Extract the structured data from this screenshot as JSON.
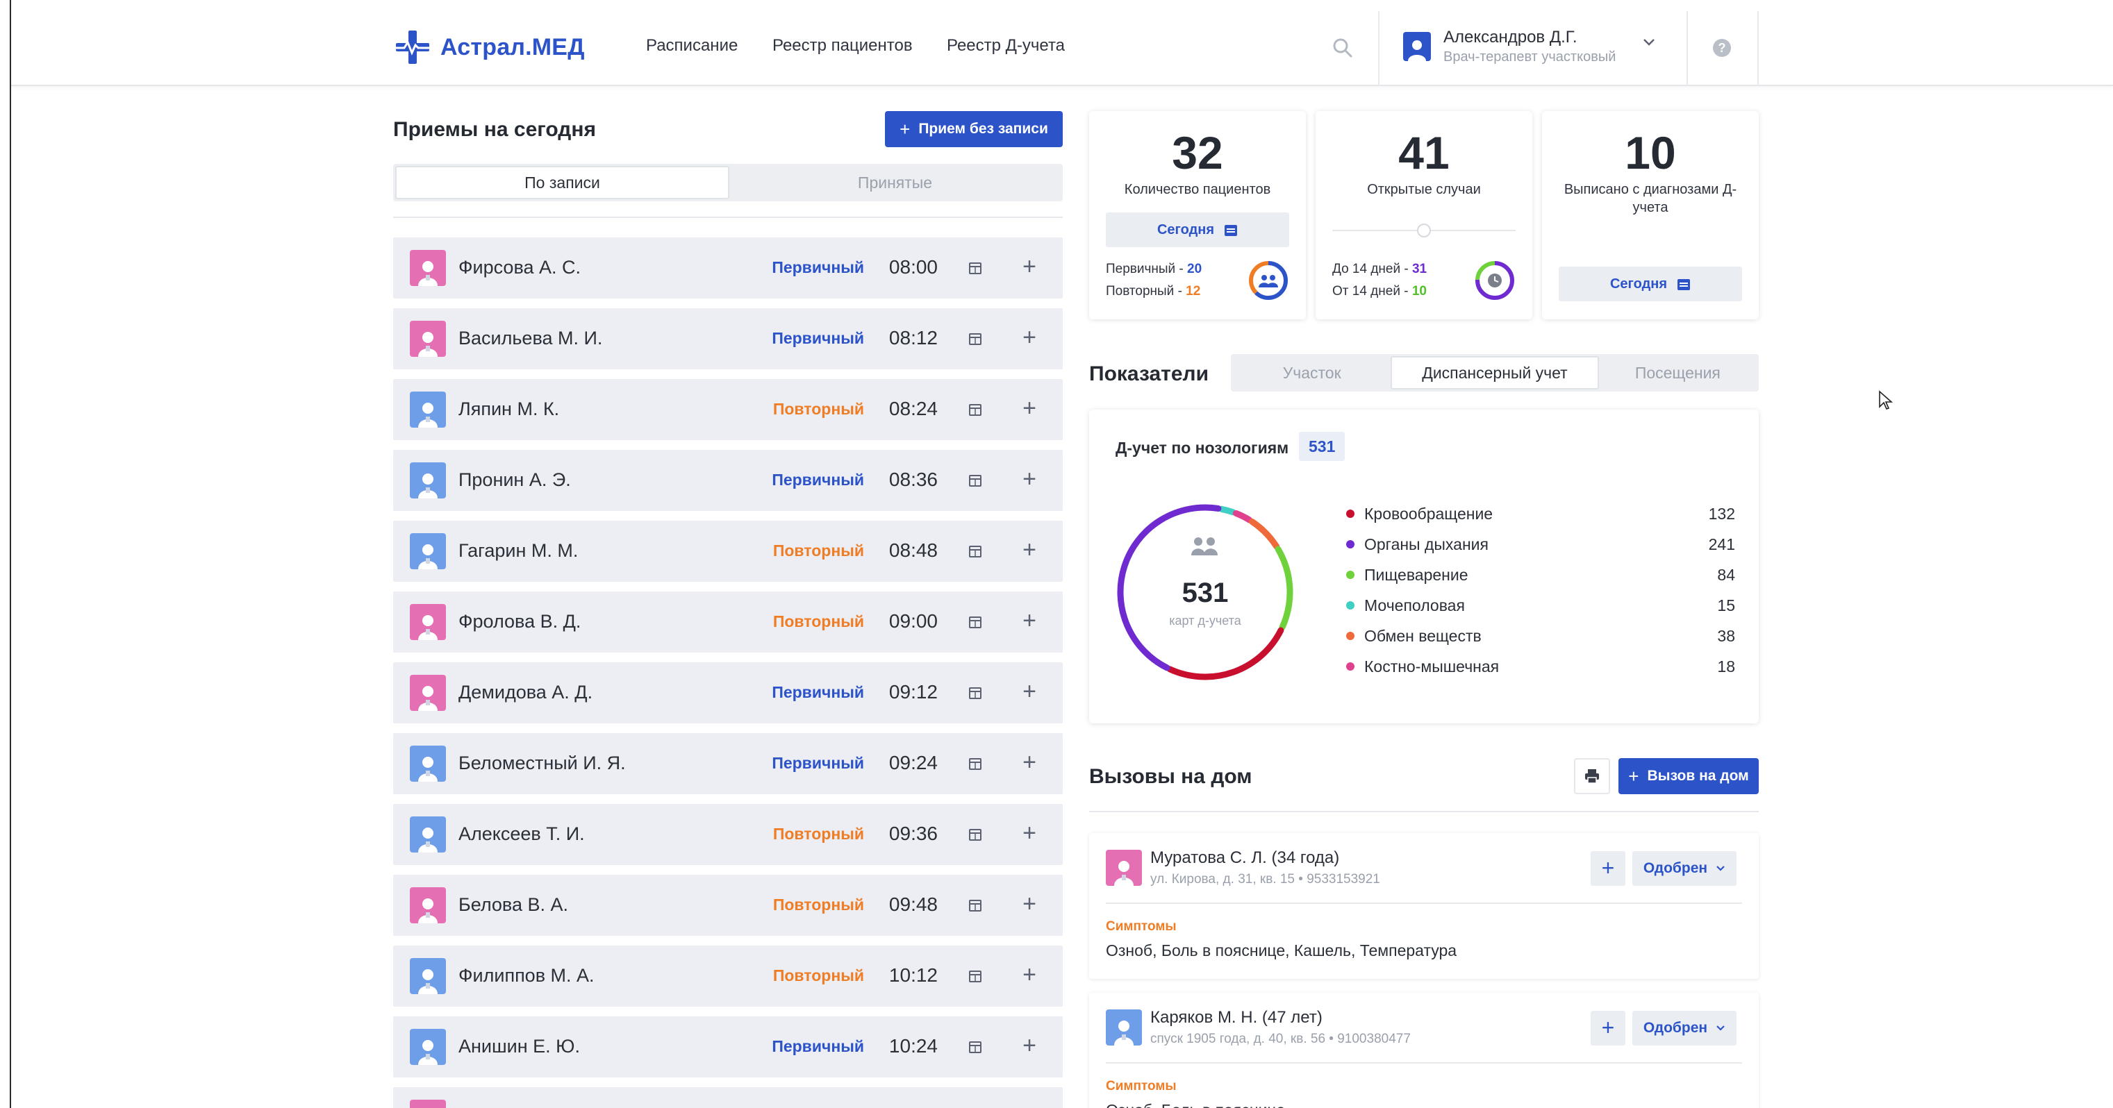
{
  "app": {
    "name": "Астрал.МЕД"
  },
  "nav": {
    "items": [
      "Расписание",
      "Реестр пациентов",
      "Реестр Д-учета"
    ]
  },
  "user": {
    "name": "Александров Д.Г.",
    "role": "Врач-терапевт участковый"
  },
  "help": {
    "label": "?"
  },
  "appointments": {
    "title": "Приемы на сегодня",
    "add_button": "Прием без записи",
    "tabs": [
      {
        "label": "По записи",
        "active": true
      },
      {
        "label": "Принятые",
        "active": false
      }
    ],
    "rows": [
      {
        "name": "Фирсова А. С.",
        "type": "Первичный",
        "time": "08:00",
        "gender": "female"
      },
      {
        "name": "Васильева М. И.",
        "type": "Первичный",
        "time": "08:12",
        "gender": "female"
      },
      {
        "name": "Ляпин М. К.",
        "type": "Повторный",
        "time": "08:24",
        "gender": "male"
      },
      {
        "name": "Пронин А. Э.",
        "type": "Первичный",
        "time": "08:36",
        "gender": "male"
      },
      {
        "name": "Гагарин М. М.",
        "type": "Повторный",
        "time": "08:48",
        "gender": "male"
      },
      {
        "name": "Фролова В. Д.",
        "type": "Повторный",
        "time": "09:00",
        "gender": "female"
      },
      {
        "name": "Демидова А. Д.",
        "type": "Первичный",
        "time": "09:12",
        "gender": "female"
      },
      {
        "name": "Беломестный И. Я.",
        "type": "Первичный",
        "time": "09:24",
        "gender": "male"
      },
      {
        "name": "Алексеев Т. И.",
        "type": "Повторный",
        "time": "09:36",
        "gender": "male"
      },
      {
        "name": "Белова В. А.",
        "type": "Повторный",
        "time": "09:48",
        "gender": "female"
      },
      {
        "name": "Филиппов М. А.",
        "type": "Повторный",
        "time": "10:12",
        "gender": "male"
      },
      {
        "name": "Анишин Е. Ю.",
        "type": "Первичный",
        "time": "10:24",
        "gender": "male"
      },
      {
        "name": "",
        "type": "",
        "time": "",
        "gender": "female"
      }
    ]
  },
  "stats": {
    "patients": {
      "value": "32",
      "label": "Количество пациентов",
      "button": "Сегодня",
      "primary_label": "Первичный - ",
      "primary_value": "20",
      "repeat_label": "Повторный - ",
      "repeat_value": "12"
    },
    "cases": {
      "value": "41",
      "label": "Открытые случаи",
      "lt_label": "До 14 дней - ",
      "lt_value": "31",
      "gt_label": "От 14 дней - ",
      "gt_value": "10"
    },
    "discharged": {
      "value": "10",
      "label": "Выписано с диагнозами Д-учета",
      "button": "Сегодня"
    }
  },
  "indicators": {
    "title": "Показатели",
    "tabs": [
      {
        "label": "Участок",
        "active": false
      },
      {
        "label": "Диспансерный учет",
        "active": true
      },
      {
        "label": "Посещения",
        "active": false
      }
    ],
    "card_title": "Д-учет по нозологиям",
    "total": "531",
    "total_caption": "карт д-учета",
    "legend": [
      {
        "name": "Кровообращение",
        "value": 132,
        "color": "#c8102e"
      },
      {
        "name": "Органы дыхания",
        "value": 241,
        "color": "#6f2bd0"
      },
      {
        "name": "Пищеварение",
        "value": 84,
        "color": "#6fd23c"
      },
      {
        "name": "Мочеполовая",
        "value": 15,
        "color": "#3fcfc4"
      },
      {
        "name": "Обмен веществ",
        "value": 38,
        "color": "#ef6a3a"
      },
      {
        "name": "Костно-мышечная",
        "value": 18,
        "color": "#e0418f"
      }
    ]
  },
  "calls": {
    "title": "Вызовы на дом",
    "add_button": "Вызов на дом",
    "items": [
      {
        "name": "Муратова С. Л. (34 года)",
        "address": "ул. Кирова, д. 31, кв. 15 • 9533153921",
        "status": "Одобрен",
        "symptoms_label": "Симптомы",
        "symptoms": "Озноб, Боль в пояснице, Кашель, Температура",
        "gender": "female"
      },
      {
        "name": "Каряков М. Н. (47 лет)",
        "address": "спуск 1905 года, д. 40, кв. 56 • 9100380477",
        "status": "Одобрен",
        "symptoms_label": "Симптомы",
        "symptoms": "Озноб, Боль в пояснице",
        "gender": "male"
      }
    ]
  },
  "colors": {
    "primary": "#2c54c8",
    "first_visit": "#2c54c8",
    "repeat_visit": "#ef7d26",
    "female": "#e56fb3",
    "male": "#6f9ee8"
  }
}
